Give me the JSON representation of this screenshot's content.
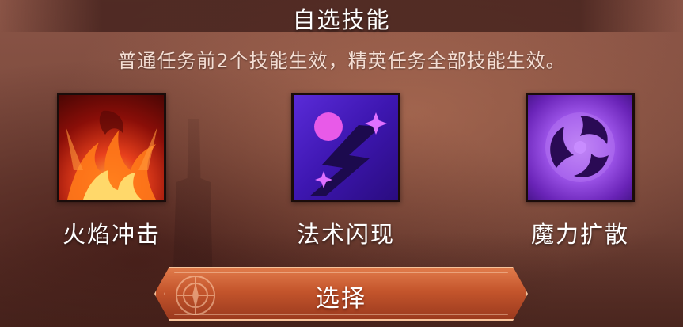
{
  "dialog": {
    "title": "自选技能",
    "description": "普通任务前2个技能生效，精英任务全部技能生效。"
  },
  "skills": [
    {
      "name": "火焰冲击",
      "icon": "fire-blast-icon"
    },
    {
      "name": "法术闪现",
      "icon": "arcane-blink-icon"
    },
    {
      "name": "魔力扩散",
      "icon": "mana-spiral-icon"
    }
  ],
  "actions": {
    "select_label": "选择"
  },
  "colors": {
    "button_accent": "#c4552c",
    "text": "#ffffff"
  }
}
